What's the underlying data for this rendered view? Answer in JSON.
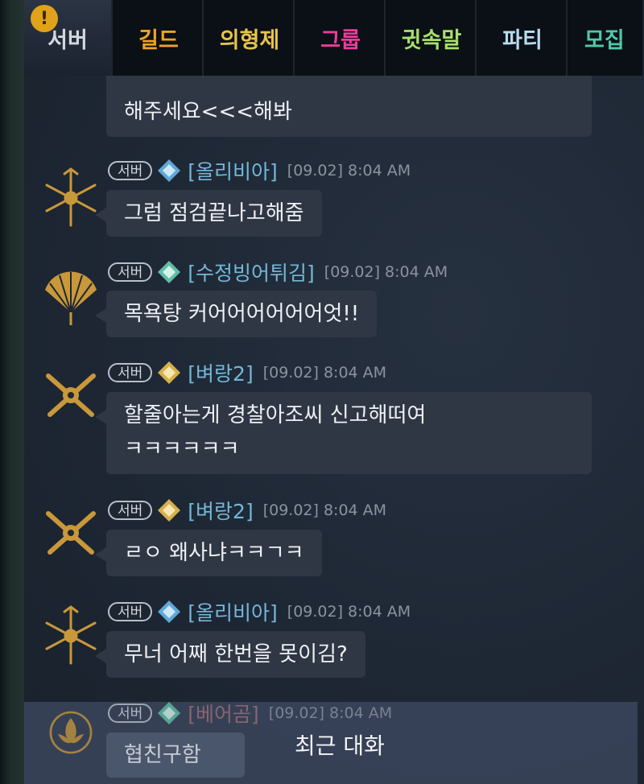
{
  "tabs": [
    {
      "label": "서버",
      "color": "#d4d8de"
    },
    {
      "label": "길드",
      "color": "#f0a321"
    },
    {
      "label": "의형제",
      "color": "#e8c34c"
    },
    {
      "label": "그룹",
      "color": "#ea3d99"
    },
    {
      "label": "귓속말",
      "color": "#a6e06a"
    },
    {
      "label": "파티",
      "color": "#b7dcef"
    },
    {
      "label": "모집",
      "color": "#4fc9a7"
    }
  ],
  "alert_badge": "!",
  "messages": [
    {
      "lines": [
        "해주세요<<<해봐"
      ]
    },
    {
      "chip": "서버",
      "rank_icon": "blue-crystal-icon",
      "sender": "[올리비아]",
      "time": "[09.02] 8:04 AM",
      "avatar_icon": "gold-blades-emblem-icon",
      "lines": [
        "그럼 점검끝나고해줌"
      ]
    },
    {
      "chip": "서버",
      "rank_icon": "teal-crystal-icon",
      "sender": "[수정빙어튀김]",
      "time": "[09.02] 8:04 AM",
      "avatar_icon": "gold-fan-emblem-icon",
      "lines": [
        "목욕탕 커어어어어어어엇!!"
      ]
    },
    {
      "chip": "서버",
      "rank_icon": "gold-diamond-icon",
      "sender": "[벼랑2]",
      "time": "[09.02] 8:04 AM",
      "avatar_icon": "gold-crossed-guns-emblem-icon",
      "lines": [
        "할줄아는게 경찰아조씨 신고해떠여",
        "ㅋㅋㅋㅋㅋㅋ"
      ]
    },
    {
      "chip": "서버",
      "rank_icon": "gold-diamond-icon",
      "sender": "[벼랑2]",
      "time": "[09.02] 8:04 AM",
      "avatar_icon": "gold-crossed-guns-emblem-icon",
      "lines": [
        "ㄹㅇ 왜사냐ㅋㅋㄱㅋ"
      ]
    },
    {
      "chip": "서버",
      "rank_icon": "blue-crystal-icon",
      "sender": "[올리비아]",
      "time": "[09.02] 8:04 AM",
      "avatar_icon": "gold-blades-emblem-icon",
      "lines": [
        "무너 어째 한번을 못이김?"
      ]
    },
    {
      "chip": "서버",
      "rank_icon": "teal-crystal-icon",
      "sender": "[베어곰]",
      "time": "[09.02] 8:04 AM",
      "avatar_icon": "gold-lotus-emblem-icon",
      "lines": [
        "협친구함"
      ]
    }
  ],
  "recent_label": "최근 대화"
}
